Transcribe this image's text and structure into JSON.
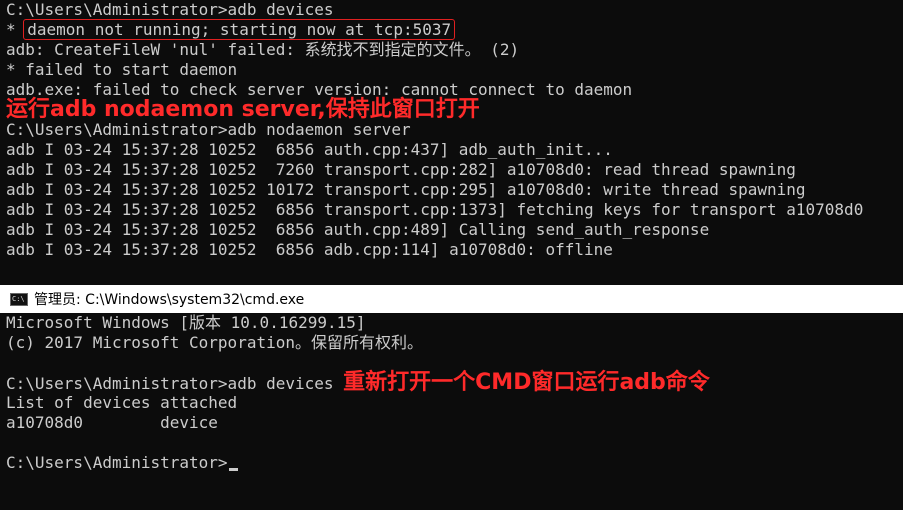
{
  "top_terminal": {
    "lines": [
      "C:\\Users\\Administrator>adb devices",
      "* ",
      "daemon not running; starting now at tcp:5037",
      "adb: CreateFileW 'nul' failed: 系统找不到指定的文件。 (2)",
      "* failed to start daemon",
      "adb.exe: failed to check server version: cannot connect to daemon",
      "C:\\Users\\Administrator>adb nodaemon server",
      "adb I 03-24 15:37:28 10252  6856 auth.cpp:437] adb_auth_init...",
      "adb I 03-24 15:37:28 10252  7260 transport.cpp:282] a10708d0: read thread spawning",
      "adb I 03-24 15:37:28 10252 10172 transport.cpp:295] a10708d0: write thread spawning",
      "adb I 03-24 15:37:28 10252  6856 transport.cpp:1373] fetching keys for transport a10708d0",
      "adb I 03-24 15:37:28 10252  6856 auth.cpp:489] Calling send_auth_response",
      "adb I 03-24 15:37:28 10252  6856 adb.cpp:114] a10708d0: offline"
    ],
    "annotation": "运行adb nodaemon server,保持此窗口打开"
  },
  "window": {
    "title": "管理员: C:\\Windows\\system32\\cmd.exe"
  },
  "bottom_terminal": {
    "lines": [
      "Microsoft Windows [版本 10.0.16299.15]",
      "(c) 2017 Microsoft Corporation。保留所有权利。",
      "",
      "C:\\Users\\Administrator>adb devices ",
      "List of devices attached",
      "a10708d0        device",
      "",
      "C:\\Users\\Administrator>"
    ],
    "annotation": "重新打开一个CMD窗口运行adb命令"
  },
  "colors": {
    "background": "#0c0c0c",
    "text": "#cccccc",
    "annotation": "#ff2a2a"
  }
}
